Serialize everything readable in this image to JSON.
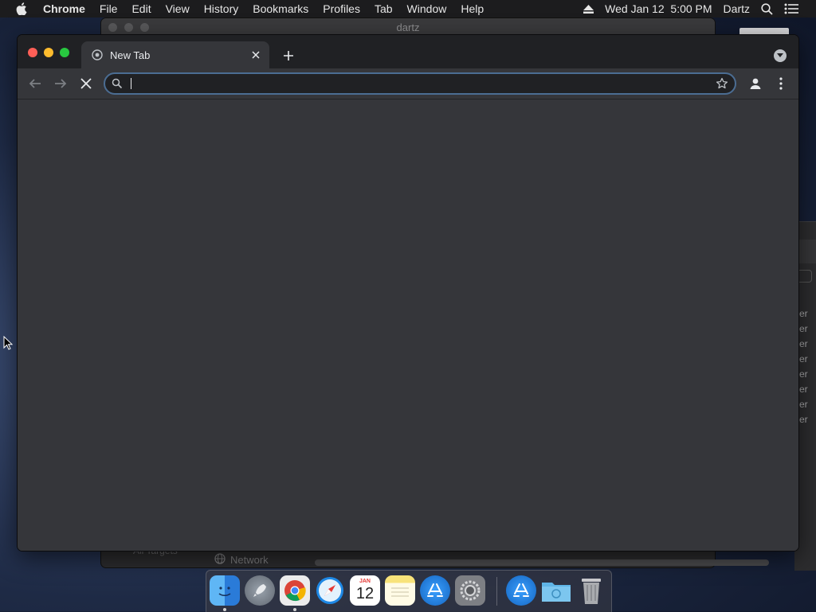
{
  "menubar": {
    "app_name": "Chrome",
    "menus": [
      "File",
      "Edit",
      "View",
      "History",
      "Bookmarks",
      "Profiles",
      "Tab",
      "Window",
      "Help"
    ],
    "clock": "Wed Jan 12  5:00 PM",
    "user": "Dartz"
  },
  "background_window": {
    "title": "dartz",
    "sidebar_label": "All Targets",
    "tab_label": "Network",
    "right_fragment_rows": [
      "er",
      "er",
      "er",
      "er",
      "er",
      "er",
      "er",
      "er"
    ]
  },
  "browser": {
    "tab_title": "New Tab",
    "omnibox": {
      "value": "",
      "placeholder": ""
    },
    "colors": {
      "tabstrip": "#202124",
      "toolbar": "#35363a",
      "omnibox_focus": "#4b6d93",
      "traffic_close": "#ff5f57",
      "traffic_minimize": "#febc2e",
      "traffic_maximize": "#28c840"
    }
  },
  "dock": {
    "apps": [
      "Finder",
      "Launchpad",
      "Google Chrome",
      "Safari",
      "Calendar",
      "Notes",
      "App Store",
      "System Preferences",
      "App Store Downloads",
      "Downloads Folder",
      "Trash"
    ],
    "calendar_month": "JAN",
    "calendar_day": "12"
  },
  "icons": [
    "apple-icon",
    "eject-icon",
    "spotlight-icon",
    "notification-center-icon",
    "chrome-favicon-icon",
    "close-icon",
    "plus-icon",
    "tab-search-icon",
    "back-arrow-icon",
    "forward-arrow-icon",
    "stop-icon",
    "search-icon",
    "bookmark-star-icon",
    "profile-icon",
    "kebab-menu-icon",
    "cursor-icon"
  ]
}
